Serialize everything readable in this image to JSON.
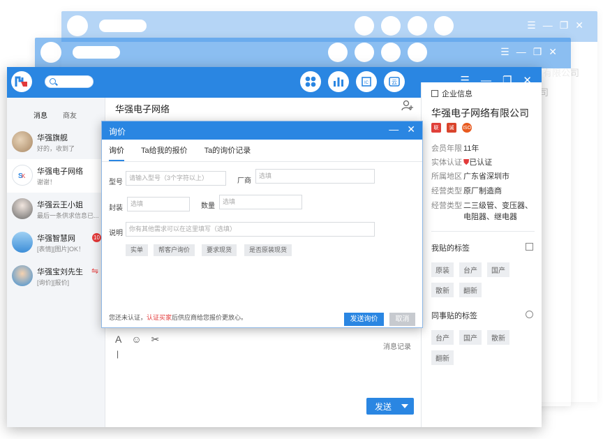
{
  "main_window": {
    "apps": [
      {
        "name": "grid-app"
      },
      {
        "name": "chart-app"
      },
      {
        "name": "ic-app",
        "label": "IC"
      },
      {
        "name": "cloud-app",
        "label": "云"
      }
    ],
    "controls": {
      "menu": "☰",
      "minimize": "—",
      "restore": "❐",
      "close": "✕"
    }
  },
  "left_panel": {
    "tabs": [
      "消息",
      "商友"
    ],
    "conversations": [
      {
        "name": "华强旗舰",
        "message": "好的，收到了",
        "avatar_color": "#b99a7a"
      },
      {
        "name": "华强电子网络",
        "message": "谢谢！",
        "avatar_color": "#ffffff",
        "selected": true
      },
      {
        "name": "华强云王小姐",
        "message": "最后一条供求信息已...",
        "avatar_color": "#888888"
      },
      {
        "name": "华强智慧网",
        "message": "[表情][图片]OK！",
        "avatar_color": "#4a9fdc",
        "badge": "10"
      },
      {
        "name": "华强宝刘先生",
        "message": "[询价][报价]",
        "avatar_color": "#3a8fd6",
        "alert": "⇋"
      }
    ]
  },
  "chat": {
    "title": "华强电子网络",
    "history_label": "消息记录",
    "send_label": "发送",
    "toolbar": {
      "font": "A",
      "emoji": "☺",
      "scissors": "✂"
    }
  },
  "right_panel": {
    "header": "企业信息",
    "company_name": "华强电子网络有限公司",
    "badges": [
      {
        "label": "联",
        "color": "#e0403a"
      },
      {
        "label": "诚",
        "color": "#d9442c"
      },
      {
        "label": "ISO",
        "color": "#e85a1f"
      }
    ],
    "info": [
      {
        "key": "会员年限",
        "value": "11年"
      },
      {
        "key": "实体认证",
        "value": "已认证"
      },
      {
        "key": "所属地区",
        "value": "广东省深圳市"
      },
      {
        "key": "经营类型",
        "value": "原厂制造商"
      },
      {
        "key": "经营类型",
        "value": "二三级管、变压器、",
        "value2": "电阻器、继电器"
      }
    ],
    "my_tags_title": "我贴的标签",
    "my_tags": [
      "原装",
      "台产",
      "国产",
      "散新",
      "翻新"
    ],
    "colleague_tags_title": "同事贴的标签",
    "colleague_tags": [
      "台产",
      "国产",
      "散新",
      "翻新"
    ]
  },
  "dialog": {
    "title": "询价",
    "tabs": [
      "询价",
      "Ta给我的报价",
      "Ta的询价记录"
    ],
    "fields": {
      "model_label": "型号",
      "model_placeholder": "请输入型号（3个字符以上）",
      "maker_label": "厂商",
      "maker_placeholder": "选填",
      "package_label": "封装",
      "package_placeholder": "选填",
      "qty_label": "数量",
      "qty_placeholder": "选填",
      "desc_label": "说明",
      "desc_placeholder": "你有其他需求可以在这里填写（选填）"
    },
    "quick_buttons": [
      "实单",
      "帮客户询价",
      "要求现货",
      "是否原装现货"
    ],
    "notice_prefix": "您还未认证，",
    "notice_link": "认证买家",
    "notice_suffix": "后供应商给您报价更放心。",
    "send_label": "发送询价",
    "cancel_label": "取消",
    "controls": {
      "minimize": "—",
      "close": "✕"
    }
  },
  "ghost": {
    "company_fragment": "有限公司",
    "fragment2": "公司"
  },
  "colors": {
    "accent": "#2a86e2",
    "alert": "#e83a3a"
  }
}
